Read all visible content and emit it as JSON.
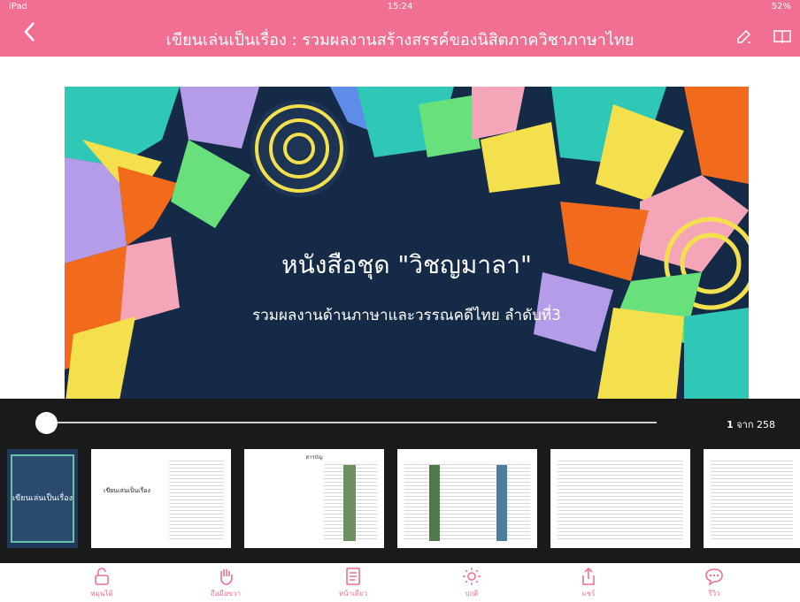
{
  "status": {
    "carrier": "iPad",
    "time": "15:24",
    "battery": "52%"
  },
  "header": {
    "title": "เขียนเล่นเป็นเรื่อง : รวมผลงานสร้างสรรค์ของนิสิตภาควิชาภาษาไทย",
    "back_icon": "chevron-left-icon",
    "edit_icon": "pencil-icon",
    "book_icon": "open-book-icon"
  },
  "page": {
    "title": "หนังสือชุด \"วิชญมาลา\"",
    "subtitle": "รวมผลงานด้านภาษาและวรรณคดีไทย ลำดับที่3"
  },
  "slider": {
    "current_page": "1",
    "total_label": "จาก 258",
    "current_page_number": 1,
    "total_pages": 258
  },
  "thumbnails": {
    "cover_label": "เขียนเล่นเป็นเรื่อง",
    "title_page_label": "เขียนเล่นเป็นเรื่อง",
    "toc_label": "สารบัญ"
  },
  "tabs": [
    {
      "label": "หมุนได้",
      "icon": "unlock-rotation-icon"
    },
    {
      "label": "ถือมือขวา",
      "icon": "hand-icon"
    },
    {
      "label": "หน้าเดียว",
      "icon": "single-page-icon"
    },
    {
      "label": "ปกติ",
      "icon": "brightness-icon"
    },
    {
      "label": "แชร์",
      "icon": "share-icon"
    },
    {
      "label": "รีวิว",
      "icon": "review-bubble-icon"
    }
  ],
  "colors": {
    "accent": "#f06f92",
    "page_bg": "#152a47",
    "overlay": "#1a1a1a"
  }
}
